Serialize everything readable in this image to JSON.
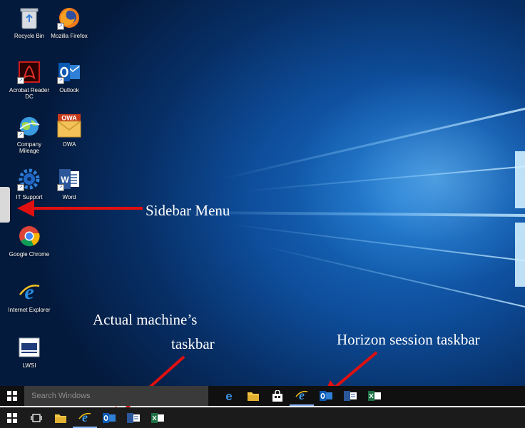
{
  "desktop": {
    "icons": [
      {
        "label": "Recycle Bin",
        "icon": "recycle-bin-icon"
      },
      {
        "label": "Mozilla Firefox",
        "icon": "firefox-icon"
      },
      {
        "label": "Acrobat Reader DC",
        "icon": "acrobat-icon"
      },
      {
        "label": "Outlook",
        "icon": "outlook-icon"
      },
      {
        "label": "Company Mileage",
        "icon": "globe-icon"
      },
      {
        "label": "OWA",
        "icon": "owa-icon"
      },
      {
        "label": "IT Support",
        "icon": "gear-icon"
      },
      {
        "label": "Word",
        "icon": "word-icon"
      },
      {
        "label": "Google Chrome",
        "icon": "chrome-icon"
      },
      {
        "label": "Internet Explorer",
        "icon": "ie-icon"
      },
      {
        "label": "LWSI",
        "icon": "lwsi-icon"
      }
    ]
  },
  "callouts": {
    "sidebar": "Sidebar Menu",
    "actual_line1": "Actual machine’s",
    "actual_line2": "taskbar",
    "horizon": "Horizon session taskbar"
  },
  "session_taskbar": {
    "search_placeholder": "Search Windows",
    "apps": [
      "edge-icon",
      "file-explorer-icon",
      "store-icon",
      "ie-icon",
      "outlook-icon",
      "word-icon",
      "excel-icon"
    ]
  },
  "actual_taskbar": {
    "apps": [
      "task-view-icon",
      "file-explorer-icon",
      "ie-icon",
      "outlook-icon",
      "word-icon",
      "excel-icon"
    ]
  },
  "colors": {
    "arrow": "#e01010",
    "taskbar": "#101010",
    "desktop_blue": "#0e4e9c"
  }
}
